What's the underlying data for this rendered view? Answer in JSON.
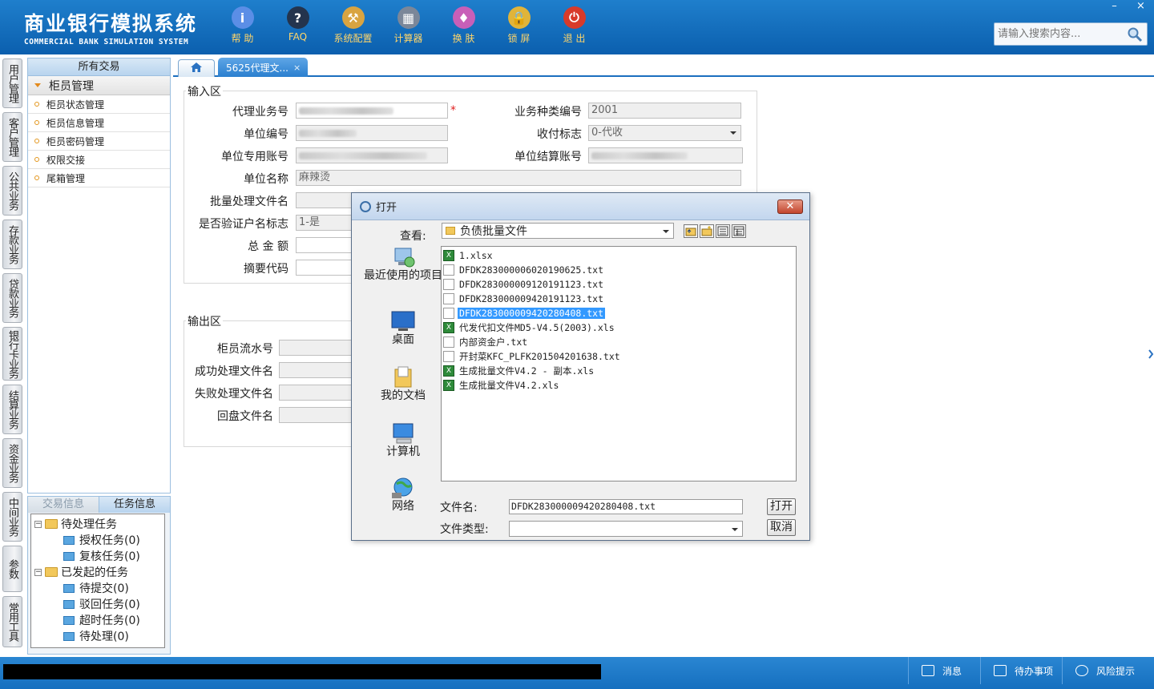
{
  "app": {
    "title_cn": "商业银行模拟系统",
    "title_en": "COMMERCIAL BANK SIMULATION SYSTEM"
  },
  "toolbar": [
    {
      "label": "帮 助",
      "icon": "info-icon",
      "glyph": "i",
      "color": "#5b8ee6"
    },
    {
      "label": "FAQ",
      "icon": "question-icon",
      "glyph": "?",
      "color": "#24344d"
    },
    {
      "label": "系统配置",
      "icon": "toolbox-icon",
      "glyph": "⚒",
      "color": "#d9a441"
    },
    {
      "label": "计算器",
      "icon": "calculator-icon",
      "glyph": "▦",
      "color": "#7b8799"
    },
    {
      "label": "换 肤",
      "icon": "shirt-icon",
      "glyph": "♦",
      "color": "#c85fb8"
    },
    {
      "label": "锁 屏",
      "icon": "lock-icon",
      "glyph": "🔒",
      "color": "#e0b43a"
    },
    {
      "label": "退 出",
      "icon": "power-icon",
      "glyph": "⏻",
      "color": "#d83a2a"
    }
  ],
  "window": {
    "minimize": "–",
    "close": "×"
  },
  "search": {
    "placeholder": "请输入搜索内容..."
  },
  "vtabs": [
    "用户管理",
    "客户管理",
    "公共业务",
    "存款业务",
    "贷款业务",
    "银行卡业务",
    "结算业务",
    "资金业务",
    "中间业务",
    "参数",
    "常用工具"
  ],
  "nav": {
    "header": "所有交易",
    "group": "柜员管理",
    "items": [
      "柜员状态管理",
      "柜员信息管理",
      "柜员密码管理",
      "权限交接",
      "尾箱管理"
    ]
  },
  "tasks": {
    "tabs": [
      "交易信息",
      "任务信息"
    ],
    "pending_label": "待处理任务",
    "pending": [
      "授权任务(0)",
      "复核任务(0)"
    ],
    "initiated_label": "已发起的任务",
    "initiated": [
      "待提交(0)",
      "驳回任务(0)",
      "超时任务(0)",
      "待处理(0)"
    ]
  },
  "tabs": {
    "active": "5625代理文...",
    "close": "×"
  },
  "form": {
    "input_legend": "输入区",
    "output_legend": "输出区",
    "agent_no_label": "代理业务号",
    "biz_type_label": "业务种类编号",
    "biz_type_value": "2001",
    "unit_no_label": "单位编号",
    "flag_label": "收付标志",
    "flag_value": "0-代收",
    "unit_account_label": "单位专用账号",
    "settle_account_label": "单位结算账号",
    "unit_name_label": "单位名称",
    "unit_name_value": "麻辣烫",
    "batch_file_label": "批量处理文件名",
    "verify_label": "是否验证户名标志",
    "verify_value": "1-是",
    "total_label": "总 金 额",
    "summary_label": "摘要代码",
    "teller_serial_label": "柜员流水号",
    "success_file_label": "成功处理文件名",
    "fail_file_label": "失败处理文件名",
    "return_file_label": "回盘文件名",
    "required_mark": "*"
  },
  "dialog": {
    "title": "打开",
    "close": "✕",
    "look_in_label": "查看:",
    "look_in_value": "负债批量文件",
    "places": [
      "最近使用的项目",
      "桌面",
      "我的文档",
      "计算机",
      "网络"
    ],
    "files": [
      {
        "name": "1.xlsx",
        "type": "xls"
      },
      {
        "name": "DFDK283000006020190625.txt",
        "type": "txt"
      },
      {
        "name": "DFDK283000009120191123.txt",
        "type": "txt"
      },
      {
        "name": "DFDK283000009420191123.txt",
        "type": "txt"
      },
      {
        "name": "DFDK283000009420280408.txt",
        "type": "txt"
      },
      {
        "name": "代发代扣文件MD5-V4.5(2003).xls",
        "type": "xls"
      },
      {
        "name": "内部资金户.txt",
        "type": "txt"
      },
      {
        "name": "开封菜KFC_PLFK201504201638.txt",
        "type": "txt"
      },
      {
        "name": "生成批量文件V4.2 - 副本.xls",
        "type": "xls"
      },
      {
        "name": "生成批量文件V4.2.xls",
        "type": "xls"
      }
    ],
    "selected_index": 4,
    "filename_label": "文件名:",
    "filename_value": "DFDK283000009420280408.txt",
    "filetype_label": "文件类型:",
    "open_button": "打开",
    "cancel_button": "取消"
  },
  "status": {
    "message": "消息",
    "todo": "待办事项",
    "risk": "风险提示"
  }
}
